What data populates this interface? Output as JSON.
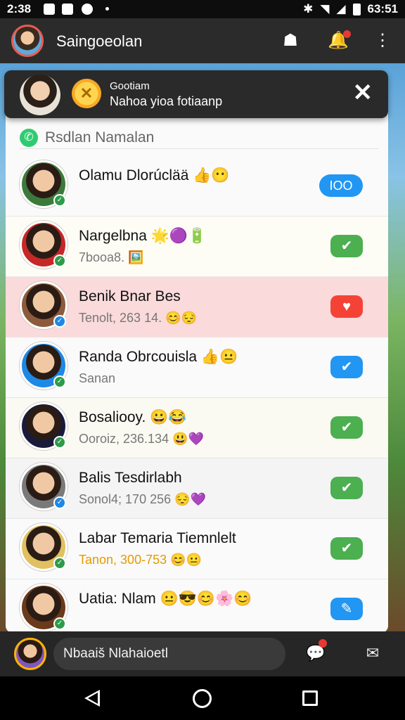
{
  "status_bar": {
    "time": "2:38",
    "right_time": "63:51",
    "icons": [
      "image-icon",
      "save-icon",
      "circle-icon",
      "bluetooth-icon",
      "wifi-icon",
      "signal-icon",
      "battery-icon"
    ]
  },
  "app_bar": {
    "title": "Saingoeolan",
    "icons": [
      "account-icon",
      "bell-icon",
      "more-icon"
    ]
  },
  "toast": {
    "title": "Gootiam",
    "message": "Nahoa yioa fotiaanp",
    "close_icon": "close-icon"
  },
  "list_header": {
    "label": "Rsdlan Namalan"
  },
  "contacts": [
    {
      "name": "Olamu Dlorúclää 👍😶",
      "sub": "",
      "action": "IOO",
      "action_color": "#2196f3",
      "avatar_bg": "#3c7a3c",
      "badge_color": "#2e9b4a",
      "highlight": ""
    },
    {
      "name": "Nargelbna 🌟🟣🔋",
      "sub": "7booa8. 🖼️",
      "action": "✔",
      "action_color": "#4caf50",
      "avatar_bg": "#c62828",
      "badge_color": "#2e9b4a",
      "highlight": "#fdfdf6"
    },
    {
      "name": "Benik Bnar Bes",
      "sub": "Tenolt, 263 14. 😊😔",
      "action": "♥",
      "action_color": "#f44336",
      "avatar_bg": "#8d5a3b",
      "badge_color": "#1e88e5",
      "highlight": "#fadada"
    },
    {
      "name": "Randa Obrcouisla 👍😐",
      "sub": "Sanan",
      "action": "✔",
      "action_color": "#2196f3",
      "avatar_bg": "#1e88e5",
      "badge_color": "#2e9b4a",
      "highlight": ""
    },
    {
      "name": "Bosaliooy. 😀😂",
      "sub": "Ooroiz, 236.134 😃💜",
      "action": "✔",
      "action_color": "#4caf50",
      "avatar_bg": "#1a1a3a",
      "badge_color": "#2e9b4a",
      "highlight": "#fafaf3"
    },
    {
      "name": "Balis Tesdirlabh",
      "sub": "Sonol4; 170 256 😔💜",
      "action": "✔",
      "action_color": "#4caf50",
      "avatar_bg": "#7a7a7a",
      "badge_color": "#1e88e5",
      "highlight": "#f4f4f4"
    },
    {
      "name": "Labar Temaria Tiemnlelt",
      "sub": "Tanon, 300-753 😊😐",
      "action": "✔",
      "action_color": "#4caf50",
      "avatar_bg": "#e0c060",
      "badge_color": "#2e9b4a",
      "highlight": "",
      "sub_color": "#e69a00"
    },
    {
      "name": "Uatia: Nlam 😐😎😊🌸😊",
      "sub": "",
      "action": "✎",
      "action_color": "#2196f3",
      "avatar_bg": "#6a3a1a",
      "badge_color": "#2e9b4a",
      "highlight": ""
    }
  ],
  "bottom_bar": {
    "input_value": "Nbaaiš Nlahaioetl",
    "icons": [
      "chat-icon",
      "send-icon"
    ]
  },
  "nav_bar": {
    "icons": [
      "back-icon",
      "home-icon",
      "recents-icon"
    ]
  }
}
